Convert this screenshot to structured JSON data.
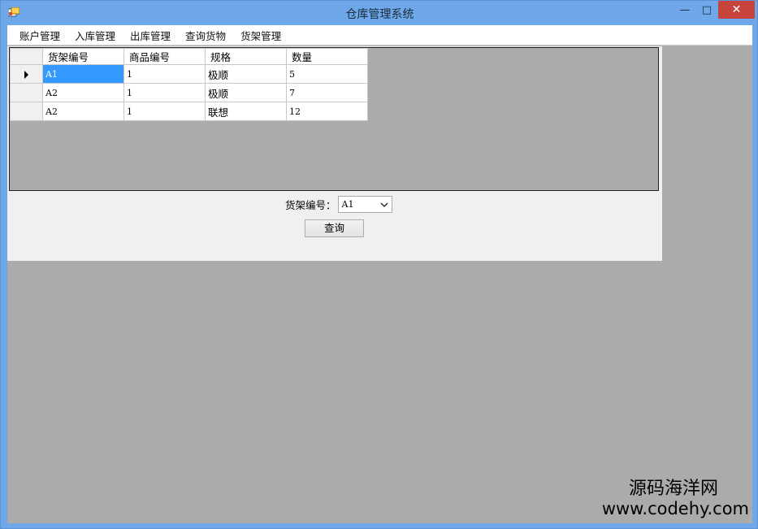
{
  "window": {
    "title": "仓库管理系统",
    "minimize": "—",
    "maximize": "□",
    "close": "✕"
  },
  "menu": [
    {
      "label": "账户管理"
    },
    {
      "label": "入库管理"
    },
    {
      "label": "出库管理"
    },
    {
      "label": "查询货物"
    },
    {
      "label": "货架管理"
    }
  ],
  "grid": {
    "columns": [
      "货架编号",
      "商品编号",
      "规格",
      "数量"
    ],
    "rows": [
      [
        "A1",
        "1",
        "极顺",
        "5"
      ],
      [
        "A2",
        "1",
        "极顺",
        "7"
      ],
      [
        "A2",
        "1",
        "联想",
        "12"
      ]
    ]
  },
  "filter": {
    "label": "货架编号：",
    "selected": "A1"
  },
  "query_button": "查询",
  "watermark": {
    "cn": "源码海洋网",
    "url": "www.codehy.com"
  }
}
